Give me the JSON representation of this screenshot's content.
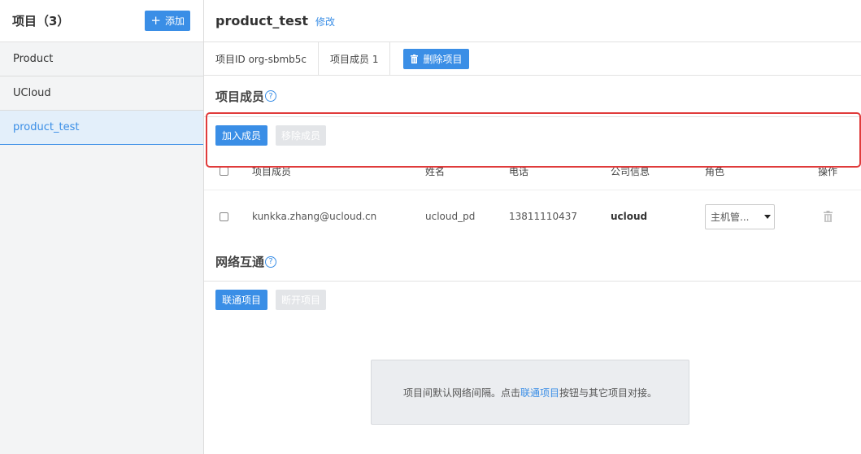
{
  "sidebar": {
    "title": "项目（3）",
    "add_label": "添加",
    "items": [
      {
        "label": "Product"
      },
      {
        "label": "UCloud"
      },
      {
        "label": "product_test"
      }
    ]
  },
  "header": {
    "project_name": "product_test",
    "edit_label": "修改"
  },
  "info_bar": {
    "project_id": "项目ID org-sbmb5c",
    "member_count": "项目成员 1",
    "delete_label": "删除项目"
  },
  "members_section": {
    "title": "项目成员",
    "add_member_label": "加入成员",
    "remove_member_label": "移除成员",
    "columns": [
      "项目成员",
      "姓名",
      "电话",
      "公司信息",
      "角色",
      "操作"
    ],
    "rows": [
      {
        "email": "kunkka.zhang@ucloud.cn",
        "name": "ucloud_pd",
        "phone": "13811110437",
        "company": "ucloud",
        "role": "主机管..."
      }
    ]
  },
  "network_section": {
    "title": "网络互通",
    "connect_label": "联通项目",
    "disconnect_label": "断开项目",
    "notice_prefix": "项目间默认网络间隔。点击",
    "notice_link": "联通项目",
    "notice_suffix": "按钮与其它项目对接。"
  },
  "colors": {
    "accent": "#3a8ee6",
    "highlight": "#e03b3b",
    "disabled": "#e3e5e8"
  },
  "icons": {
    "add": "plus-icon",
    "delete_project": "trash-icon",
    "help": "question-icon",
    "row_delete": "trash-icon",
    "dropdown": "caret-down-icon"
  }
}
